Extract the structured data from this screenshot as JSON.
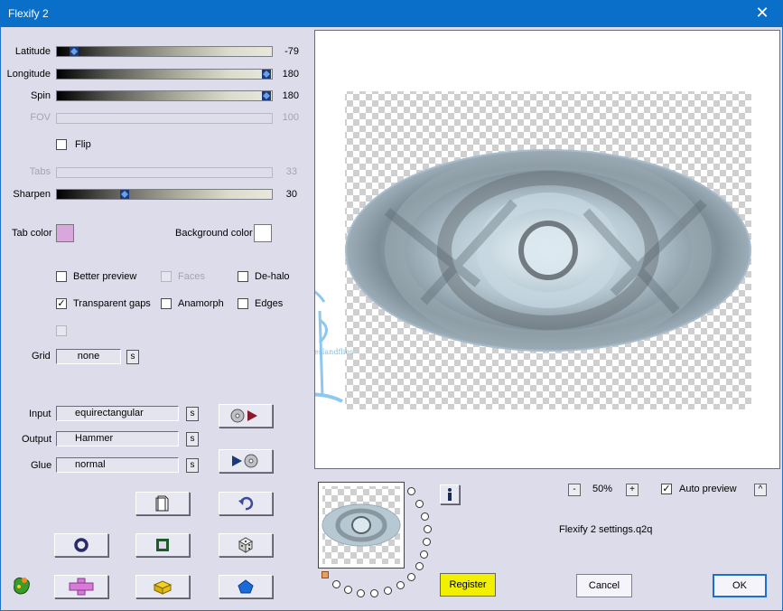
{
  "window": {
    "title": "Flexify 2",
    "close_icon": "close-icon"
  },
  "sliders": {
    "latitude": {
      "label": "Latitude",
      "value": "-79",
      "fraction": 0.08
    },
    "longitude": {
      "label": "Longitude",
      "value": "180",
      "fraction": 1.0
    },
    "spin": {
      "label": "Spin",
      "value": "180",
      "fraction": 1.0
    },
    "fov": {
      "label": "FOV",
      "value": "100",
      "enabled": false
    },
    "tabs": {
      "label": "Tabs",
      "value": "33",
      "enabled": false
    },
    "sharpen": {
      "label": "Sharpen",
      "value": "30",
      "fraction": 0.3
    }
  },
  "flip": {
    "label": "Flip",
    "checked": false
  },
  "colors": {
    "tab_label": "Tab color",
    "tab_value": "#d8a8dc",
    "background_label": "Background color",
    "background_value": "#ffffff"
  },
  "options": {
    "better_preview": {
      "label": "Better preview",
      "checked": false
    },
    "faces": {
      "label": "Faces",
      "checked": false,
      "enabled": false
    },
    "de_halo": {
      "label": "De-halo",
      "checked": false
    },
    "transparent_gaps": {
      "label": "Transparent gaps",
      "checked": true
    },
    "anamorph": {
      "label": "Anamorph",
      "checked": false
    },
    "edges": {
      "label": "Edges",
      "checked": false
    }
  },
  "grid": {
    "label": "Grid",
    "value": "none",
    "s_label": "s"
  },
  "projection": {
    "input_label": "Input",
    "input_value": "equirectangular",
    "output_label": "Output",
    "output_value": "Hammer",
    "glue_label": "Glue",
    "glue_value": "normal",
    "s_label": "s"
  },
  "zoom": {
    "minus": "-",
    "value": "50%",
    "plus": "+"
  },
  "auto_preview": {
    "label": "Auto preview",
    "checked": true,
    "arrow": "^"
  },
  "settings_file": "Flexify 2 settings.q2q",
  "info_icon": "info-icon",
  "buttons": {
    "register": "Register",
    "cancel": "Cancel",
    "ok": "OK"
  },
  "watermark": "©Bloemetjeslandflies"
}
